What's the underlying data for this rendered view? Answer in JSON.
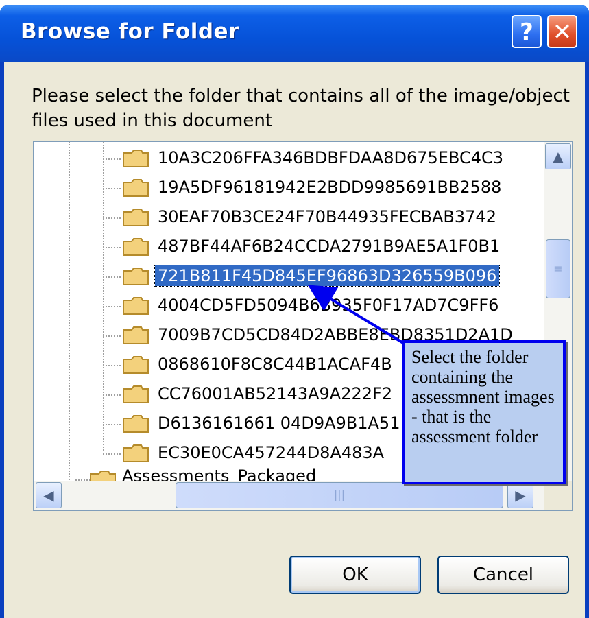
{
  "window": {
    "title": "Browse for Folder",
    "help_label": "?",
    "close_label": "✕"
  },
  "prompt": "Please select the folder that contains all of the image/object files used in this document",
  "tree": {
    "items": [
      {
        "label": "10A3C206FFA346BDBFDAA8D675EBC4C3",
        "selected": false
      },
      {
        "label": "19A5DF96181942E2BDD9985691BB2588",
        "selected": false
      },
      {
        "label": "30EAF70B3CE24F70B44935FECBAB3742",
        "selected": false
      },
      {
        "label": "487BF44AF6B24CCDA2791B9AE5A1F0B1",
        "selected": false
      },
      {
        "label": "721B811F45D845EF96863D326559B096",
        "selected": true
      },
      {
        "label": "4004CD5FD5094B6B935F0F17AD7C9FF6",
        "selected": false
      },
      {
        "label": "7009B7CD5CD84D2ABBE8EBD8351D2A1D",
        "selected": false
      },
      {
        "label": "0868610F8C8C44B1ACAF4B",
        "selected": false
      },
      {
        "label": "CC76001AB52143A9A222F2",
        "selected": false
      },
      {
        "label": "D6136161661 04D9A9B1A51",
        "selected": false
      },
      {
        "label": "EC30E0CA457244D8A483A",
        "selected": false
      }
    ],
    "parent_item": "Assessments_Packaged"
  },
  "buttons": {
    "ok": "OK",
    "cancel": "Cancel"
  },
  "callout": "Select the folder containing the assessmnent images - that is the assessment folder",
  "icons": {
    "folder": "folder-icon",
    "scroll_up": "▲",
    "scroll_left": "◀",
    "scroll_right": "▶",
    "thumb_grip": "≡",
    "hthumb_grip": "|||"
  },
  "colors": {
    "title_bar": "#0652d8",
    "selection": "#316ac5",
    "callout_bg": "#b9cef0",
    "callout_border": "#0000ee"
  }
}
